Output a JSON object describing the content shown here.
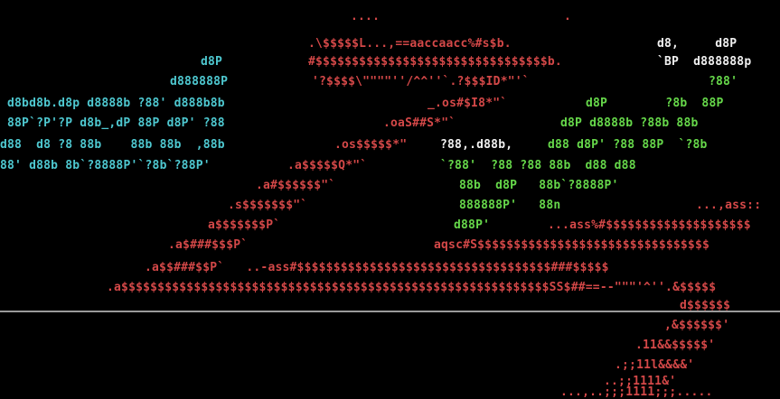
{
  "colors": {
    "background": "#000000",
    "red": "#d44848",
    "cyan": "#4ec8d0",
    "green": "#66d84a",
    "white": "#f0f0f0",
    "gray": "#7c7c7c",
    "divider": "#9a9a9a"
  },
  "art": {
    "r0_red": "....",
    "r0_red_b": ".",
    "r1_red": ".\\$$$$$L...,==aaccaacc%#s$b.",
    "r1_white": "d8,     d8P",
    "r2_cyan": "d8P",
    "r2_red": "#$$$$$$$$$$$$$$$$$$$$$$$$$$$$$$$$b.",
    "r2_white": "`BP  d888888p",
    "r3_cyan": "d888888P",
    "r3_red": "'?$$$$\\\"\"\"\"''/^^''`.?$$$ID*\"'`",
    "r3_green": "?88'",
    "r4_cyan": "d8bd8b.d8p d8888b ?88' d888b8b",
    "r4_red": "_.os#$I8*\"`",
    "r4_green": "d8P        ?8b  88P",
    "r5_cyan": "88P`?P'?P d8b_,dP 88P d8P' ?88",
    "r5_red": ".oaS##S*\"`",
    "r5_green": "d8P d8888b ?88b 88b",
    "r6_cyan": "d88  d8 ?8 88b    88b 88b  ,88b",
    "r6_red": ".os$$$$$*\"",
    "r6_white": "?88,.d88b,",
    "r6_green": "d88 d8P' ?88 88P  `?8b",
    "r7_cyan": "88' d88b 8b`?8888P'`?8b`?88P'",
    "r7_red": ".a$$$$$Q*\"`",
    "r7_green": "`?88'  ?88 ?88 88b  d88 d88",
    "r8_red": ".a#$$$$$$\"`",
    "r8_green": "88b  d8P   88b`?8888P'",
    "r9_red": ".s$$$$$$$\"`",
    "r9_green": "888888P'   88n",
    "r9_red2": "...,ass::",
    "r10_red": "a$$$$$$$P`",
    "r10_green": "d88P'",
    "r10_red2": "...ass%#$$$$$$$$$$$$$$$$$$$$",
    "r11_red": ".a$###$$$P`",
    "r11_red2": "aqsc#S$$$$$$$$$$$$$$$$$$$$$$$$$$$$$$$$",
    "r12_red": ".a$$###$$P`   ..-ass#$$$$$$$$$$$$$$$$$$$$$$$$$$$$$$$$$$$###$$$$$",
    "r13_red": ".a$$$$$$$$$$$$$$$$$$$$$$$$$$$$$$$$$$$$$$$$$$$$$$$$$$$$$$$$$$$SS$##==--\"\"\"'^''.&$$$$$",
    "r14_red": "d$$$$$$",
    "r15_red": ",&$$$$$$'",
    "r16_red": ".11&&$$$$$'",
    "r17_red": ".;;11l&&&&'",
    "r18_red": "..;;1111&'",
    "r19_red": "...,..;;;1111;;;....."
  }
}
